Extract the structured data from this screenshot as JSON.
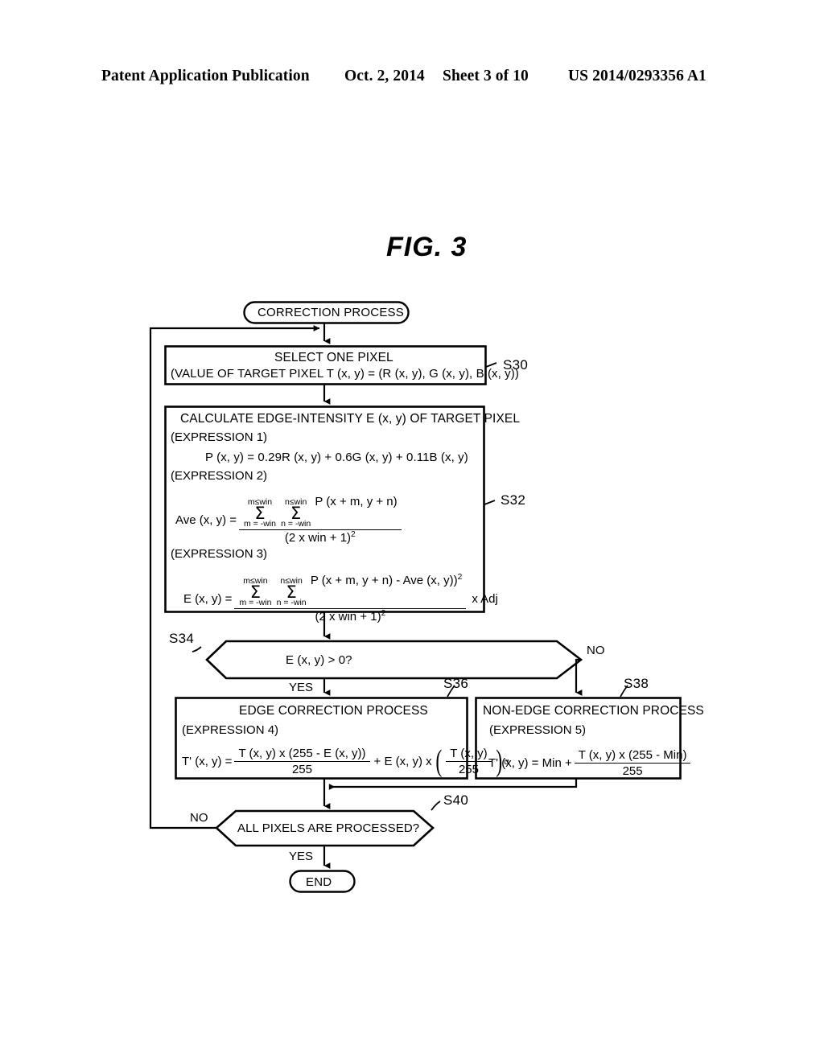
{
  "header": {
    "publication": "Patent Application Publication",
    "date": "Oct. 2, 2014",
    "sheet": "Sheet 3 of 10",
    "patent_number": "US 2014/0293356 A1"
  },
  "figure": {
    "title": "FIG. 3"
  },
  "flowchart": {
    "start": {
      "label": "CORRECTION PROCESS"
    },
    "end": {
      "label": "END"
    },
    "s30": {
      "ref": "S30",
      "line1": "SELECT ONE PIXEL",
      "line2": "(VALUE OF TARGET PIXEL T (x, y) = (R (x, y), G (x, y), B (x, y))"
    },
    "s32": {
      "ref": "S32",
      "title": "CALCULATE EDGE-INTENSITY E (x, y) OF TARGET PIXEL",
      "expr1_label": "(EXPRESSION 1)",
      "expr1": "P (x, y) = 0.29R (x, y) + 0.6G (x, y) + 0.11B (x, y)",
      "expr2_label": "(EXPRESSION 2)",
      "expr2": {
        "lhs": "Ave (x, y) =",
        "sum1_top": "m≤win",
        "sum1_bot": "m = -win",
        "sum2_top": "n≤win",
        "sum2_bot": "n = -win",
        "numerator_tail": "P (x + m, y + n)",
        "denominator": "(2 x win + 1)",
        "denominator_exp": "2"
      },
      "expr3_label": "(EXPRESSION 3)",
      "expr3": {
        "lhs": "E (x, y) =",
        "sum1_top": "m≤win",
        "sum1_bot": "m = -win",
        "sum2_top": "n≤win",
        "sum2_bot": "n = -win",
        "numerator_tail": "P (x + m, y + n) - Ave (x, y))",
        "numerator_exp": "2",
        "denominator": "(2 x win + 1)",
        "denominator_exp": "2",
        "trailing": "x Adj"
      }
    },
    "s34": {
      "ref": "S34",
      "condition": "E (x, y) > 0?",
      "yes_label": "YES",
      "no_label": "NO"
    },
    "s36": {
      "ref": "S36",
      "title": "EDGE CORRECTION PROCESS",
      "expr4_label": "(EXPRESSION 4)",
      "expr4": {
        "lhs": "T' (x, y) =",
        "num1": "T (x, y) x (255 - E (x, y))",
        "den1": "255",
        "mid": "+ E (x, y) x",
        "num2": "T (x, y)",
        "den2": "255",
        "exponent": "α"
      }
    },
    "s38": {
      "ref": "S38",
      "title": "NON-EDGE CORRECTION PROCESS",
      "expr5_label": "(EXPRESSION 5)",
      "expr5": {
        "lhs": "T' (x, y) = Min +",
        "num": "T (x, y) x (255 - Min)",
        "den": "255"
      }
    },
    "s40": {
      "ref": "S40",
      "condition": "ALL PIXELS ARE PROCESSED?",
      "yes_label": "YES",
      "no_label": "NO"
    }
  }
}
